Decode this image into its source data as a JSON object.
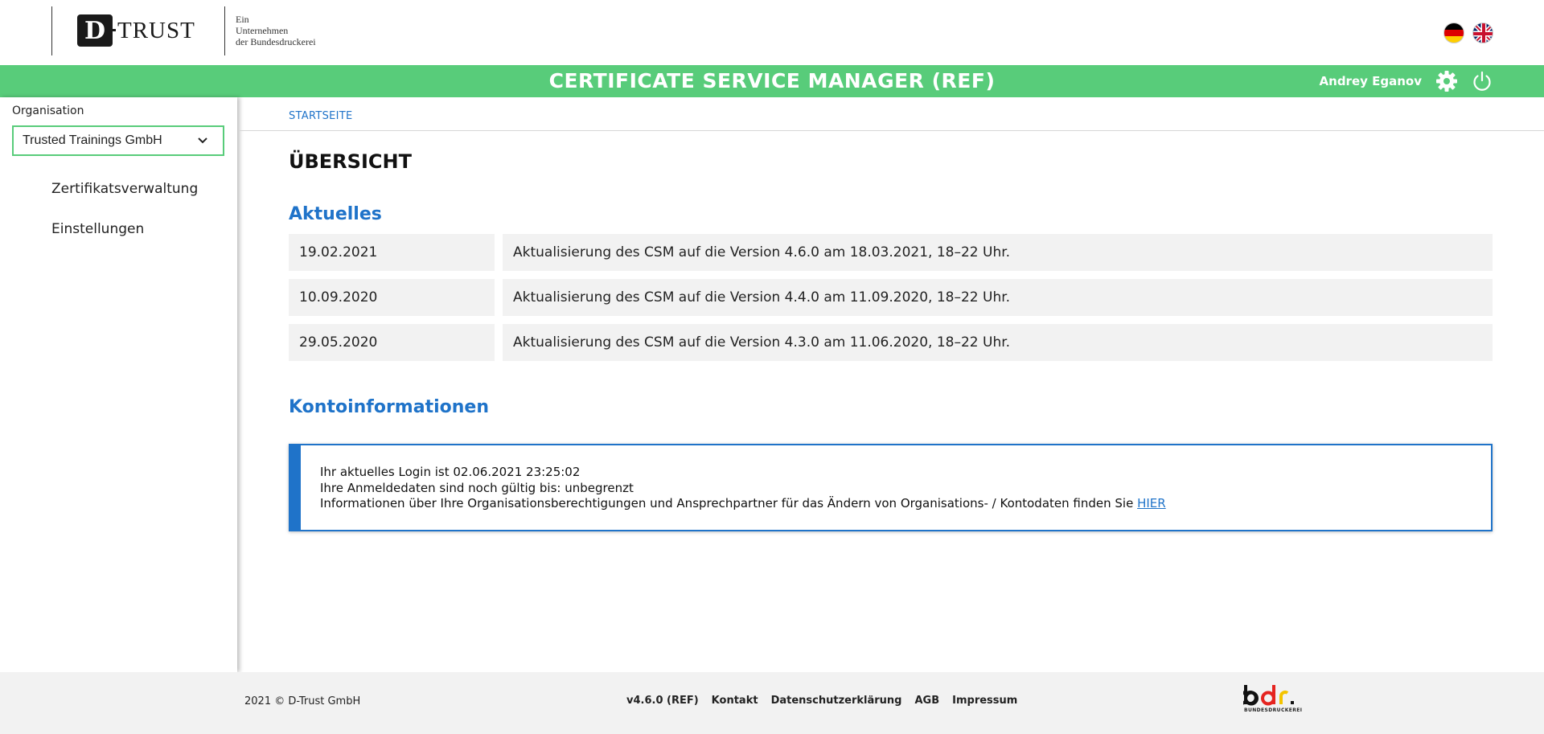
{
  "header": {
    "logo_text": "TRUST",
    "logo_letter": "D",
    "tagline": [
      "Ein",
      "Unternehmen",
      "der Bundesdruckerei"
    ],
    "languages": [
      "de",
      "en"
    ]
  },
  "titlebar": {
    "app_title": "CERTIFICATE SERVICE MANAGER (REF)",
    "user_name": "Andrey Eganov",
    "color": "#58cc7a"
  },
  "sidebar": {
    "org_label": "Organisation",
    "org_selected": "Trusted Trainings GmbH",
    "items": [
      {
        "label": "Zertifikatsverwaltung"
      },
      {
        "label": "Einstellungen"
      }
    ]
  },
  "main": {
    "breadcrumb": "STARTSEITE",
    "page_title": "ÜBERSICHT",
    "news_heading": "Aktuelles",
    "news": [
      {
        "date": "19.02.2021",
        "text": "Aktualisierung des CSM auf die Version 4.6.0 am 18.03.2021, 18–22 Uhr."
      },
      {
        "date": "10.09.2020",
        "text": "Aktualisierung des CSM auf die Version 4.4.0 am 11.09.2020, 18–22 Uhr."
      },
      {
        "date": "29.05.2020",
        "text": "Aktualisierung des CSM auf die Version 4.3.0 am 11.06.2020, 18–22 Uhr."
      }
    ],
    "account_heading": "Kontoinformationen",
    "account": {
      "line1": "Ihr aktuelles Login ist 02.06.2021 23:25:02",
      "line2": "Ihre Anmeldedaten sind noch gültig bis: unbegrenzt",
      "line3": "Informationen über Ihre Organisationsberechtigungen und Ansprechpartner für das Ändern von Organisations- / Kontodaten finden Sie",
      "link": "HIER"
    }
  },
  "footer": {
    "copyright": "2021 © D-Trust GmbH",
    "version": "v4.6.0 (REF)",
    "links": [
      "Kontakt",
      "Datenschutzerklärung",
      "AGB",
      "Impressum"
    ],
    "brand_sub": "BUNDESDRUCKEREI"
  },
  "colors": {
    "accent": "#1f73c9",
    "green": "#58cc7a"
  }
}
